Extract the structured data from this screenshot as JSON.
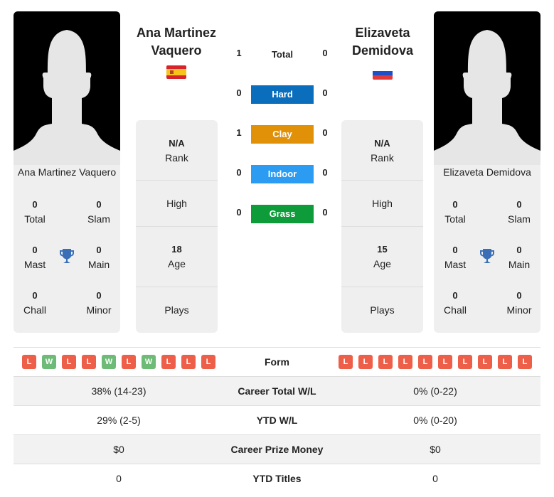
{
  "colors": {
    "hard": "#0a6ebd",
    "clay": "#e09108",
    "indoor": "#2b9cf2",
    "grass": "#0e9b3a",
    "loss": "#ee5f4a",
    "win": "#6dbb76",
    "trophy": "#3a6fb7"
  },
  "player1": {
    "name": "Ana Martinez Vaquero",
    "header_line1": "Ana Martinez",
    "header_line2": "Vaquero",
    "flag": "spain-flag",
    "card_name": "Ana Martinez Vaquero",
    "titles": {
      "total": {
        "value": "0",
        "label": "Total"
      },
      "slam": {
        "value": "0",
        "label": "Slam"
      },
      "mast": {
        "value": "0",
        "label": "Mast"
      },
      "main": {
        "value": "0",
        "label": "Main"
      },
      "chall": {
        "value": "0",
        "label": "Chall"
      },
      "minor": {
        "value": "0",
        "label": "Minor"
      }
    },
    "info": {
      "rank_value": "N/A",
      "rank_label": "Rank",
      "high_label": "High",
      "age_value": "18",
      "age_label": "Age",
      "plays_label": "Plays"
    },
    "form": [
      "L",
      "W",
      "L",
      "L",
      "W",
      "L",
      "W",
      "L",
      "L",
      "L"
    ],
    "career_wl": "38% (14-23)",
    "ytd_wl": "29% (2-5)",
    "prize_money": "$0",
    "ytd_titles": "0"
  },
  "player2": {
    "name": "Elizaveta Demidova",
    "header_line1": "Elizaveta",
    "header_line2": "Demidova",
    "flag": "russia-flag",
    "card_name": "Elizaveta Demidova",
    "titles": {
      "total": {
        "value": "0",
        "label": "Total"
      },
      "slam": {
        "value": "0",
        "label": "Slam"
      },
      "mast": {
        "value": "0",
        "label": "Mast"
      },
      "main": {
        "value": "0",
        "label": "Main"
      },
      "chall": {
        "value": "0",
        "label": "Chall"
      },
      "minor": {
        "value": "0",
        "label": "Minor"
      }
    },
    "info": {
      "rank_value": "N/A",
      "rank_label": "Rank",
      "high_label": "High",
      "age_value": "15",
      "age_label": "Age",
      "plays_label": "Plays"
    },
    "form": [
      "L",
      "L",
      "L",
      "L",
      "L",
      "L",
      "L",
      "L",
      "L",
      "L"
    ],
    "career_wl": "0% (0-22)",
    "ytd_wl": "0% (0-20)",
    "prize_money": "$0",
    "ytd_titles": "0"
  },
  "h2h": {
    "total": {
      "label": "Total",
      "p1": "1",
      "p2": "0"
    },
    "hard": {
      "label": "Hard",
      "p1": "0",
      "p2": "0"
    },
    "clay": {
      "label": "Clay",
      "p1": "1",
      "p2": "0"
    },
    "indoor": {
      "label": "Indoor",
      "p1": "0",
      "p2": "0"
    },
    "grass": {
      "label": "Grass",
      "p1": "0",
      "p2": "0"
    }
  },
  "table": {
    "form_label": "Form",
    "career_wl_label": "Career Total W/L",
    "ytd_wl_label": "YTD W/L",
    "prize_label": "Career Prize Money",
    "ytd_titles_label": "YTD Titles"
  }
}
